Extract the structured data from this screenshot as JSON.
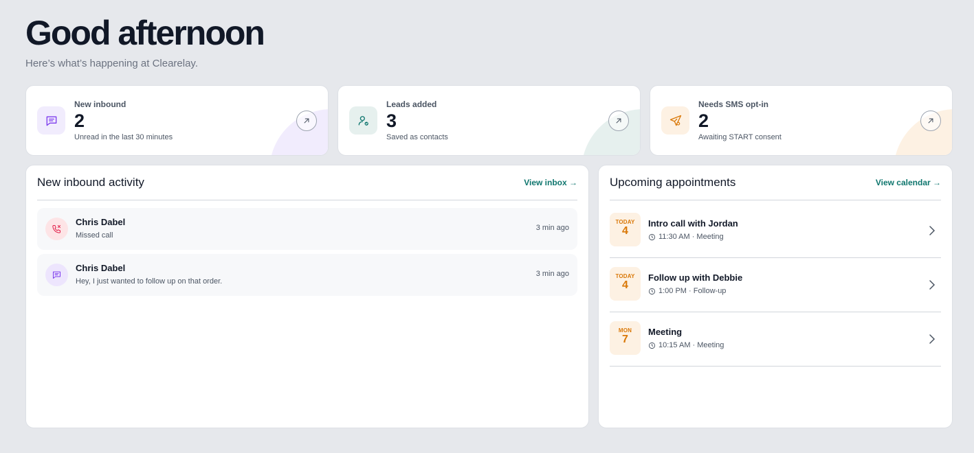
{
  "header": {
    "title": "Good afternoon",
    "subtitle": "Here’s what’s happening at Clearelay."
  },
  "stats": [
    {
      "label": "New inbound",
      "value": "2",
      "sub": "Unread in the last 30 minutes",
      "icon": "message-icon",
      "accent": "#7c3aed",
      "tint": "#f1ecfd"
    },
    {
      "label": "Leads added",
      "value": "3",
      "sub": "Saved as contacts",
      "icon": "user-check-icon",
      "accent": "#0f766e",
      "tint": "#e6f0ee"
    },
    {
      "label": "Needs SMS opt-in",
      "value": "2",
      "sub": "Awaiting START consent",
      "icon": "send-icon",
      "accent": "#d97706",
      "tint": "#fdf1e3"
    }
  ],
  "activity": {
    "title": "New inbound activity",
    "link": "View inbox →",
    "items": [
      {
        "name": "Chris Dabel",
        "message": "Missed call",
        "time": "3 min ago",
        "icon": "phone-missed-icon"
      },
      {
        "name": "Chris Dabel",
        "message": "Hey, I just wanted to follow up on that order.",
        "time": "3 min ago",
        "icon": "message-icon"
      }
    ]
  },
  "appointments": {
    "title": "Upcoming appointments",
    "link": "View calendar →",
    "items": [
      {
        "day": "TODAY",
        "date": "4",
        "title": "Intro call with Jordan",
        "meta": "11:30 AM · Meeting"
      },
      {
        "day": "TODAY",
        "date": "4",
        "title": "Follow up with Debbie",
        "meta": "1:00 PM · Follow-up"
      },
      {
        "day": "MON",
        "date": "7",
        "title": "Meeting",
        "meta": "10:15 AM · Meeting"
      }
    ]
  }
}
